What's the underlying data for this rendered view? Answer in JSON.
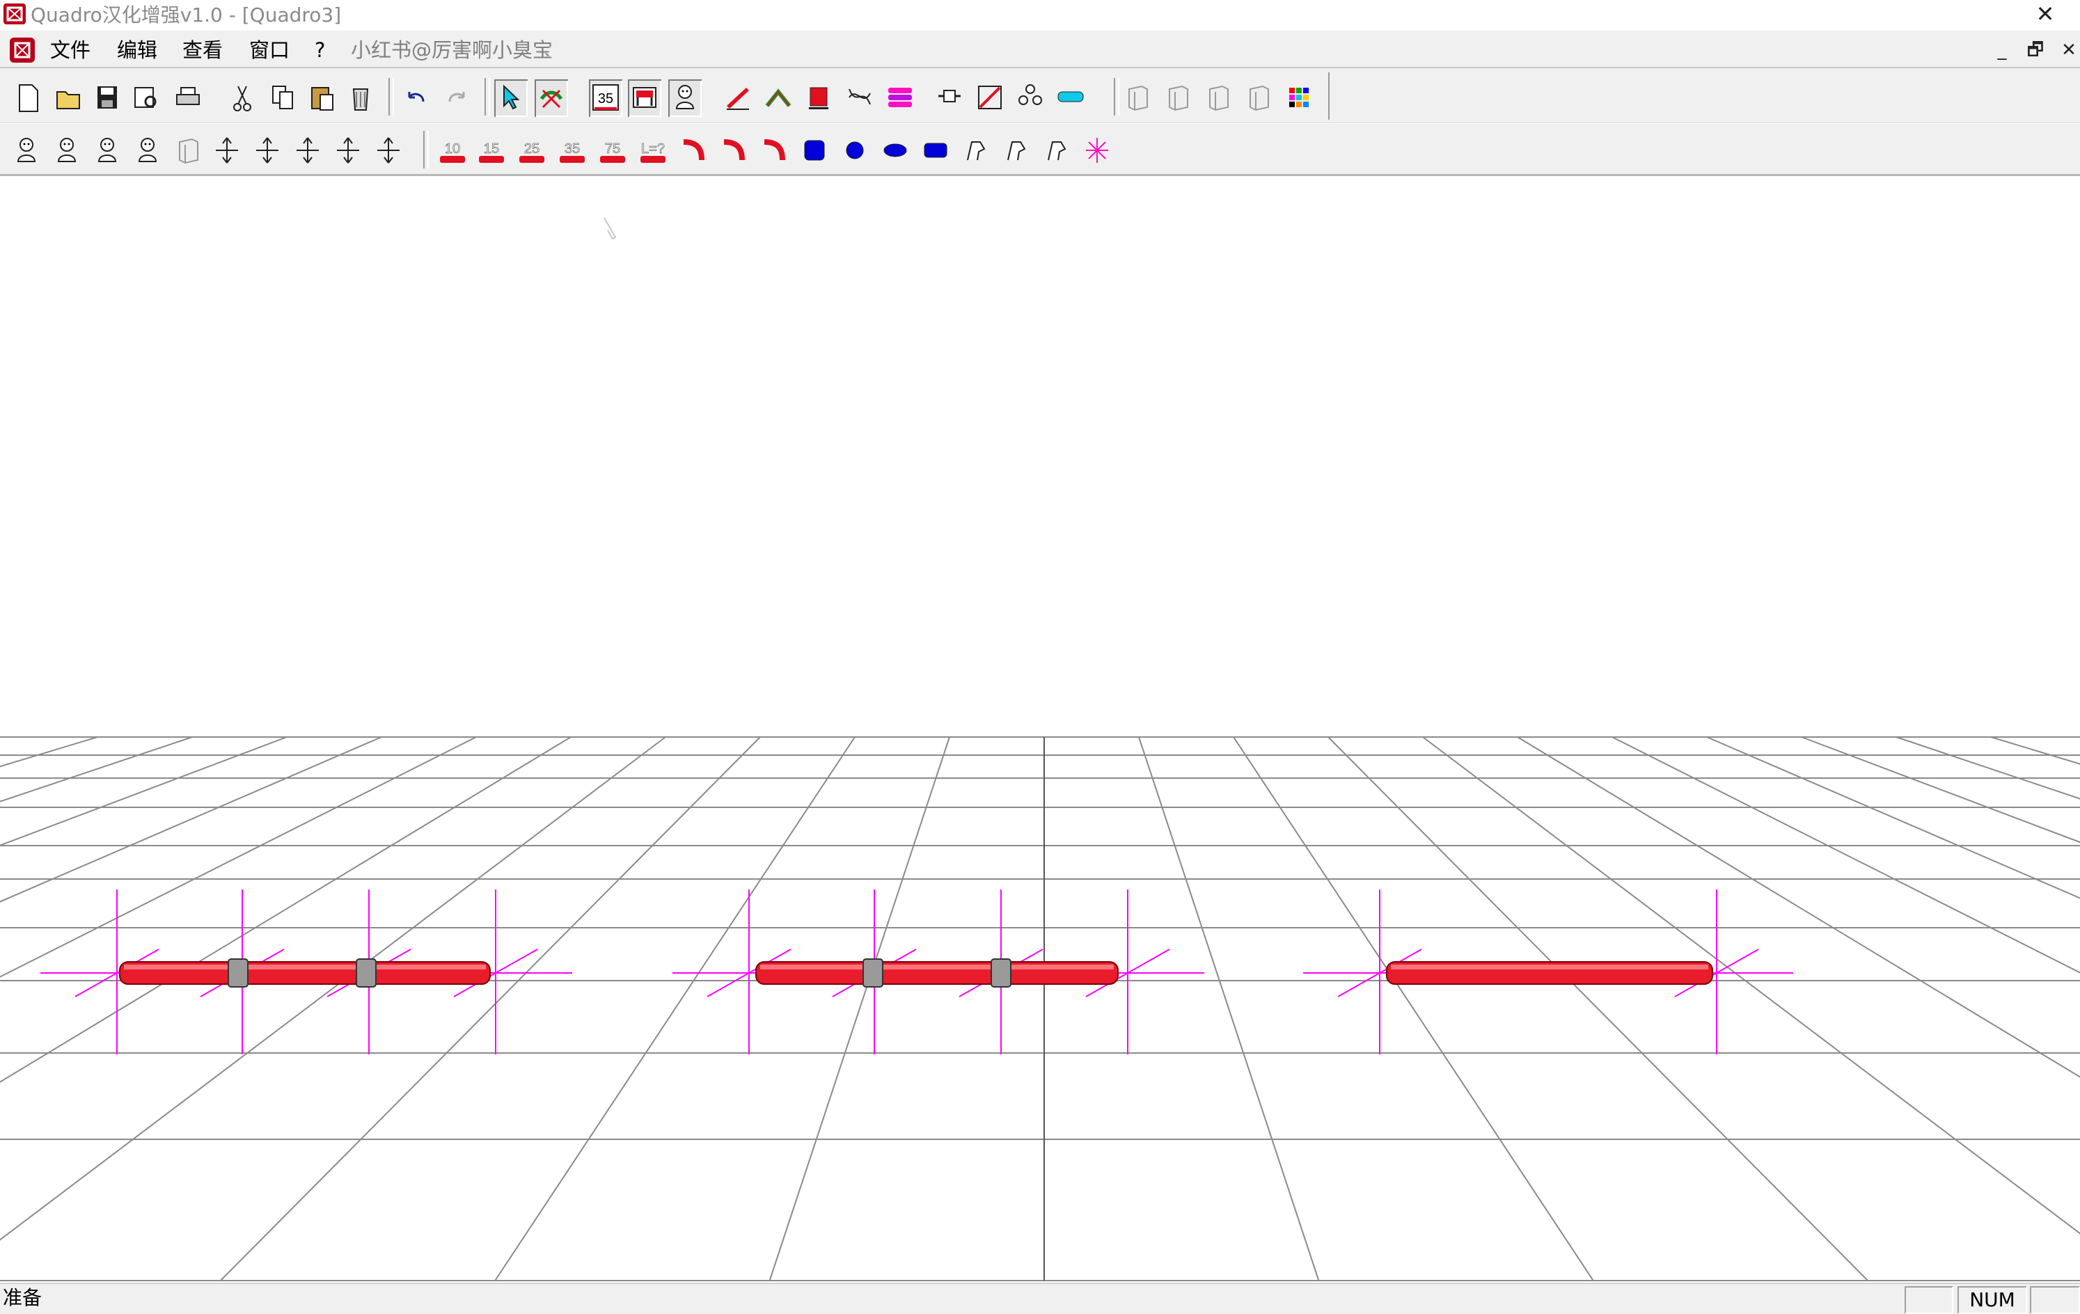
{
  "window": {
    "title": "Quadro汉化增强v1.0 - [Quadro3]",
    "close_glyph": "✕"
  },
  "menubar": {
    "items": [
      "文件",
      "编辑",
      "查看",
      "窗口",
      "?",
      "小红书@厉害啊小臭宝"
    ],
    "minimize_glyph": "_",
    "restore_glyph": "🗗",
    "close_glyph": "✕"
  },
  "toolbar_row1": {
    "buttons": [
      {
        "icon": "new-file-icon"
      },
      {
        "icon": "open-folder-icon"
      },
      {
        "icon": "save-icon"
      },
      {
        "icon": "print-preview-icon"
      },
      {
        "icon": "print-icon"
      },
      {
        "icon": "cut-icon"
      },
      {
        "icon": "copy-icon"
      },
      {
        "icon": "paste-icon"
      },
      {
        "icon": "delete-bin-icon"
      },
      {
        "icon": "undo-icon"
      },
      {
        "icon": "redo-icon"
      },
      {
        "icon": "select-pointer-icon"
      },
      {
        "icon": "no-collision-icon"
      },
      {
        "icon": "grid-35-icon",
        "label": "35"
      },
      {
        "icon": "element-frame-icon"
      },
      {
        "icon": "figure-icon"
      },
      {
        "icon": "red-ramp-icon"
      },
      {
        "icon": "green-slope-icon"
      },
      {
        "icon": "red-block-icon"
      },
      {
        "icon": "rope-net-icon"
      },
      {
        "icon": "magenta-panel-icon"
      },
      {
        "icon": "connector-icon"
      },
      {
        "icon": "diagonal-icon"
      },
      {
        "icon": "node-cluster-icon"
      },
      {
        "icon": "cyan-tube-icon"
      },
      {
        "icon": "view-front-icon"
      },
      {
        "icon": "view-side-icon"
      },
      {
        "icon": "view-top-icon"
      },
      {
        "icon": "view-3d-icon"
      },
      {
        "icon": "color-palette-icon"
      }
    ]
  },
  "toolbar_row2": {
    "buttons": [
      {
        "icon": "figure-front-icon"
      },
      {
        "icon": "figure-side-icon"
      },
      {
        "icon": "figure-back-icon"
      },
      {
        "icon": "figure-top-icon"
      },
      {
        "icon": "rotate-view-icon"
      },
      {
        "icon": "move-up-icon"
      },
      {
        "icon": "move-left-right-icon"
      },
      {
        "icon": "move-updown-icon"
      },
      {
        "icon": "move-cross-icon"
      },
      {
        "icon": "move-all-icon"
      },
      {
        "icon": "tube-10-icon",
        "label": "10"
      },
      {
        "icon": "tube-15-icon",
        "label": "15"
      },
      {
        "icon": "tube-25-icon",
        "label": "25"
      },
      {
        "icon": "tube-35-icon",
        "label": "35"
      },
      {
        "icon": "tube-75-icon",
        "label": "75"
      },
      {
        "icon": "tube-custom-icon",
        "label": "L=?"
      },
      {
        "icon": "curve-red-1-icon"
      },
      {
        "icon": "curve-red-2-icon"
      },
      {
        "icon": "curve-red-3-icon"
      },
      {
        "icon": "blue-plate-square-icon"
      },
      {
        "icon": "blue-plate-round-icon"
      },
      {
        "icon": "blue-plate-oval-icon"
      },
      {
        "icon": "blue-plate-wide-icon"
      },
      {
        "icon": "clamp-1-icon"
      },
      {
        "icon": "clamp-2-icon"
      },
      {
        "icon": "clamp-3-icon"
      },
      {
        "icon": "joint-star-icon"
      }
    ]
  },
  "status": {
    "text": "准备",
    "pane_num": "NUM"
  },
  "colors": {
    "tube": "#e81c2a",
    "axis": "#ff00ff",
    "grid": "#8a8a8a"
  }
}
